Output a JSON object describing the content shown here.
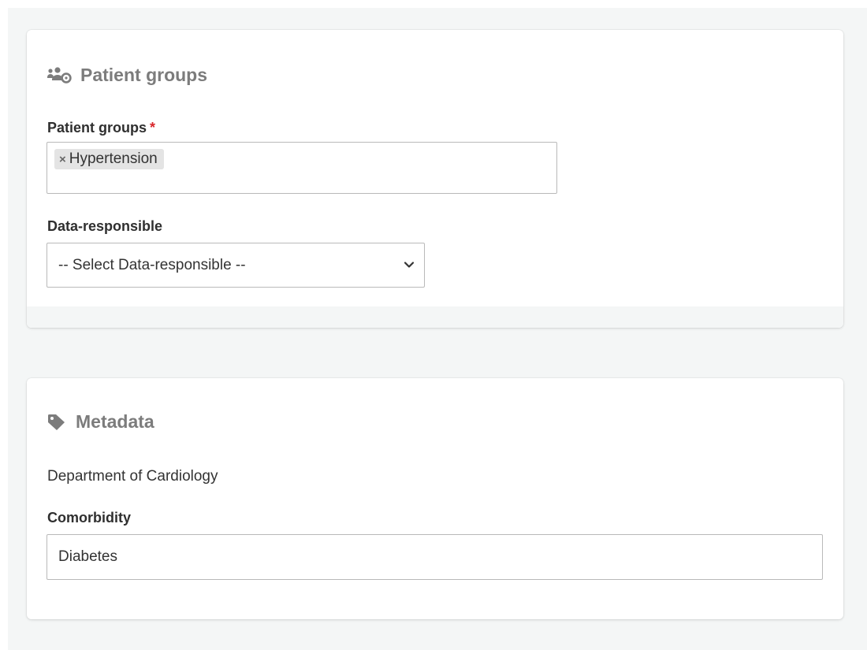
{
  "patient_groups_section": {
    "title": "Patient groups",
    "icon": "users-cog-icon",
    "field_label": "Patient groups",
    "required_marker": "*",
    "tags": [
      "Hypertension"
    ],
    "tag_remove_glyph": "×"
  },
  "data_responsible": {
    "label": "Data-responsible",
    "selected": "-- Select Data-responsible --"
  },
  "metadata_section": {
    "title": "Metadata",
    "icon": "tag-icon",
    "department": "Department of Cardiology",
    "comorbidity_label": "Comorbidity",
    "comorbidity_value": "Diabetes"
  },
  "colors": {
    "section_title": "#7c7c7c",
    "required": "#d9262b",
    "page_background": "#f4f6f6",
    "tag_background": "#e4e4e4"
  }
}
